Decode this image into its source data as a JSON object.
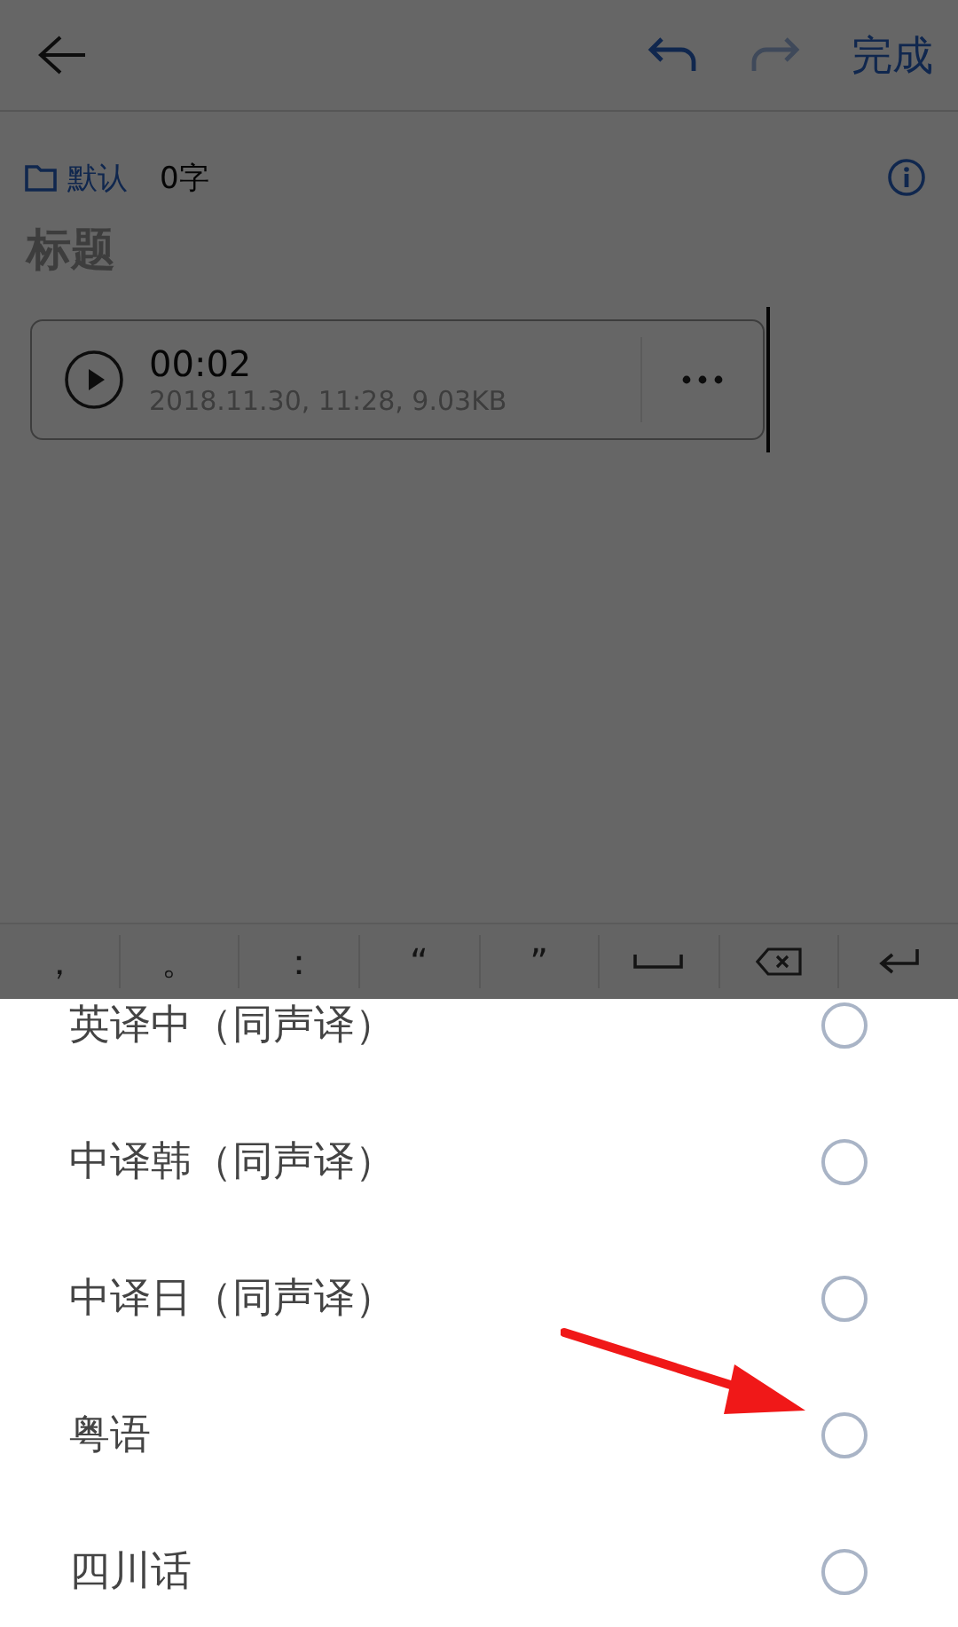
{
  "header": {
    "redo_disabled": true,
    "done": "完成"
  },
  "note": {
    "folder": "默认",
    "count": "0字",
    "title_placeholder": "标题"
  },
  "audio": {
    "duration": "00:02",
    "meta": "2018.11.30, 11:28, 9.03KB"
  },
  "keyboard": [
    {
      "kind": "char",
      "label": "，"
    },
    {
      "kind": "char",
      "label": "。"
    },
    {
      "kind": "char",
      "label": "："
    },
    {
      "kind": "char",
      "label": "“"
    },
    {
      "kind": "char",
      "label": "”"
    },
    {
      "kind": "space"
    },
    {
      "kind": "backspace"
    },
    {
      "kind": "enter"
    }
  ],
  "options": [
    {
      "label": "英译中（同声译）",
      "selected": false
    },
    {
      "label": "中译韩（同声译）",
      "selected": false
    },
    {
      "label": "中译日（同声译）",
      "selected": false
    },
    {
      "label": "粤语",
      "selected": false
    },
    {
      "label": "四川话",
      "selected": false
    }
  ]
}
